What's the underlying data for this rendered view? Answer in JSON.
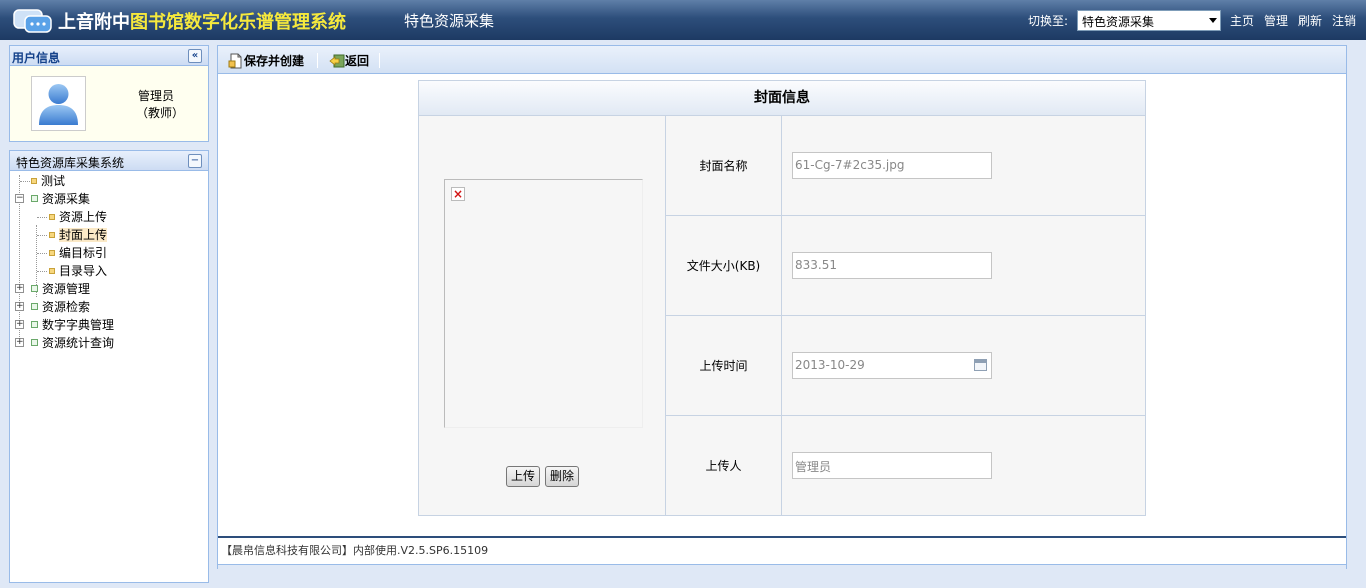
{
  "header": {
    "title_part1": "上音附中",
    "title_part2": "图书馆数字化乐谱管理系统",
    "subtitle": "特色资源采集",
    "switch_label": "切换至:",
    "switch_value": "特色资源采集",
    "links": [
      "主页",
      "管理",
      "刷新",
      "注销"
    ]
  },
  "user_panel": {
    "title": "用户信息",
    "collapse_icon": "«",
    "name": "管理员",
    "role": "（教师）"
  },
  "tree_panel": {
    "title": "特色资源库采集系统",
    "collapse_icon": "−",
    "items": [
      {
        "label": "测试"
      },
      {
        "label": "资源采集"
      },
      {
        "label": "资源上传"
      },
      {
        "label": "封面上传"
      },
      {
        "label": "编目标引"
      },
      {
        "label": "目录导入"
      },
      {
        "label": "资源管理"
      },
      {
        "label": "资源检索"
      },
      {
        "label": "数字字典管理"
      },
      {
        "label": "资源统计查询"
      }
    ],
    "expand_symbol": "+",
    "collapse_symbol": "−"
  },
  "toolbar": {
    "save_label": "保存并创建",
    "back_label": "返回"
  },
  "form": {
    "title": "封面信息",
    "upload_label": "上传",
    "delete_label": "删除",
    "broken_image_glyph": "×",
    "fields": [
      {
        "label": "封面名称",
        "value": "61-Cg-7#2c35.jpg"
      },
      {
        "label": "文件大小(KB)",
        "value": "833.51"
      },
      {
        "label": "上传时间",
        "value": "2013-10-29"
      },
      {
        "label": "上传人",
        "value": "管理员"
      }
    ]
  },
  "footer": {
    "text": "【晨帛信息科技有限公司】内部使用.V2.5.SP6.15109"
  }
}
